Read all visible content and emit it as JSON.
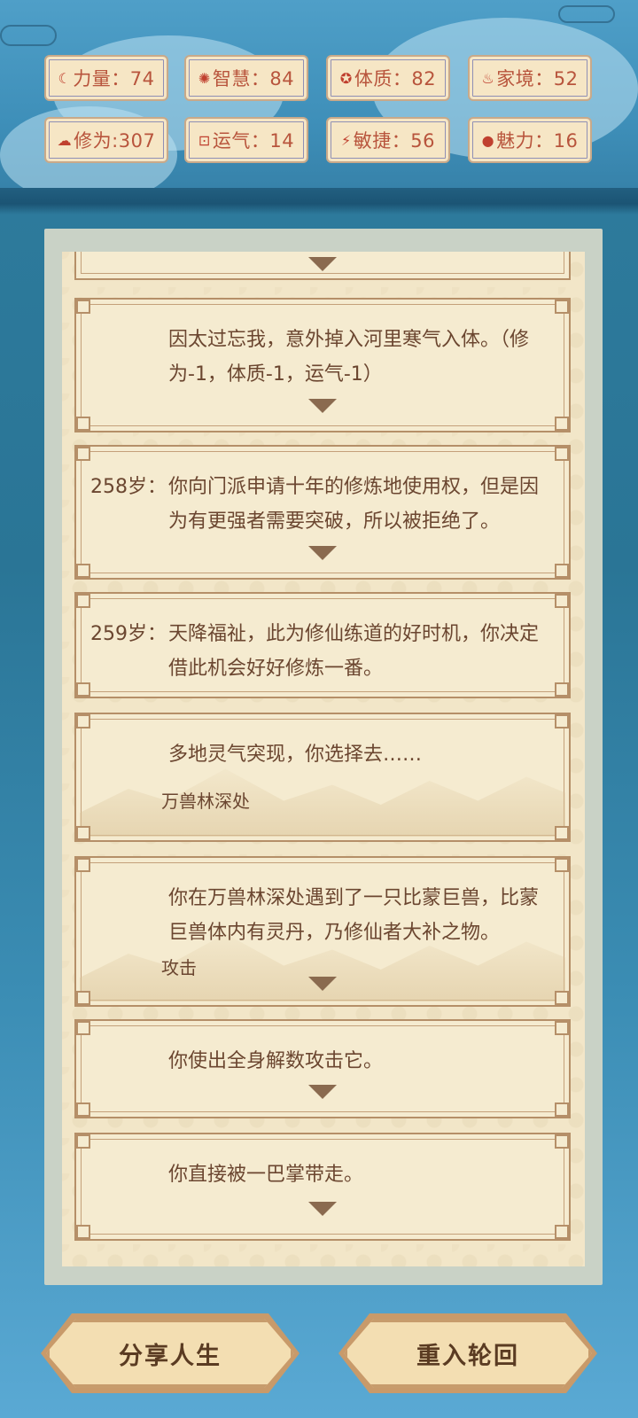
{
  "stats": [
    {
      "icon": "strength-icon",
      "glyph": "☾",
      "label": "力量：74"
    },
    {
      "icon": "wisdom-icon",
      "glyph": "✺",
      "label": "智慧：84"
    },
    {
      "icon": "constitution-icon",
      "glyph": "✪",
      "label": "体质：82"
    },
    {
      "icon": "family-icon",
      "glyph": "♨",
      "label": "家境：52"
    },
    {
      "icon": "cultivation-icon",
      "glyph": "☁",
      "label": "修为:307"
    },
    {
      "icon": "luck-icon",
      "glyph": "⊡",
      "label": "运气：14"
    },
    {
      "icon": "agility-icon",
      "glyph": "⚡",
      "label": "敏捷：56"
    },
    {
      "icon": "charm-icon",
      "glyph": "●",
      "label": "魅力：16"
    }
  ],
  "events": [
    {
      "age": "",
      "text": "因太过忘我，意外掉入河里寒气入体。（修为-1，体质-1，运气-1）"
    },
    {
      "age": "258岁：",
      "text": "你向门派申请十年的修炼地使用权，但是因为有更强者需要突破，所以被拒绝了。"
    },
    {
      "age": "259岁：",
      "text": "天降福祉，此为修仙练道的好时机，你决定借此机会好好修炼一番。"
    },
    {
      "age": "",
      "text": "多地灵气突现，你选择去……",
      "option": "万兽林深处"
    },
    {
      "age": "",
      "text": "你在万兽林深处遇到了一只比蒙巨兽，比蒙巨兽体内有灵丹，乃修仙者大补之物。",
      "option": "攻击"
    },
    {
      "age": "",
      "text": "你使出全身解数攻击它。"
    },
    {
      "age": "",
      "text": "你直接被一巴掌带走。"
    }
  ],
  "buttons": {
    "share": "分享人生",
    "restart": "重入轮回"
  },
  "colors": {
    "stat_text": "#b8543c",
    "card_bg": "#f5ebd0",
    "card_border": "#b58f68",
    "text": "#6b4630",
    "sky": "#2f7d9f"
  }
}
